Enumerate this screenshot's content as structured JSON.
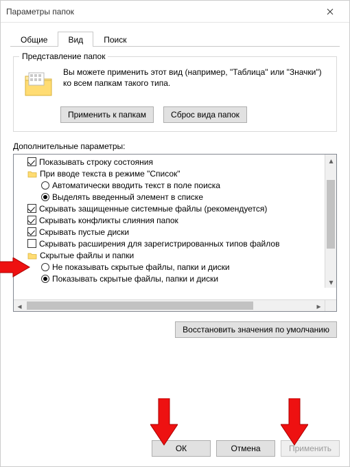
{
  "window": {
    "title": "Параметры папок"
  },
  "tabs": {
    "general": "Общие",
    "view": "Вид",
    "search": "Поиск"
  },
  "folder_views": {
    "legend": "Представление папок",
    "text": "Вы можете применить этот вид (например, \"Таблица\" или \"Значки\") ко всем папкам такого типа.",
    "apply_btn": "Применить к папкам",
    "reset_btn": "Сброс вида папок"
  },
  "advanced": {
    "label": "Дополнительные параметры:",
    "items": [
      {
        "kind": "check",
        "checked": true,
        "label": "Показывать строку состояния"
      },
      {
        "kind": "folder",
        "label": "При вводе текста в режиме \"Список\""
      },
      {
        "kind": "radio",
        "checked": false,
        "child": true,
        "label": "Автоматически вводить текст в поле поиска"
      },
      {
        "kind": "radio",
        "checked": true,
        "child": true,
        "label": "Выделять введенный элемент в списке"
      },
      {
        "kind": "check",
        "checked": true,
        "label": "Скрывать защищенные системные файлы (рекомендуется)"
      },
      {
        "kind": "check",
        "checked": true,
        "label": "Скрывать конфликты слияния папок"
      },
      {
        "kind": "check",
        "checked": true,
        "label": "Скрывать пустые диски"
      },
      {
        "kind": "check",
        "checked": false,
        "label": "Скрывать расширения для зарегистрированных типов файлов"
      },
      {
        "kind": "folder",
        "label": "Скрытые файлы и папки"
      },
      {
        "kind": "radio",
        "checked": false,
        "child": true,
        "label": "Не показывать скрытые файлы, папки и диски"
      },
      {
        "kind": "radio",
        "checked": true,
        "child": true,
        "label": "Показывать скрытые файлы, папки и диски"
      }
    ],
    "restore_btn": "Восстановить значения по умолчанию"
  },
  "footer": {
    "ok": "ОК",
    "cancel": "Отмена",
    "apply": "Применить"
  }
}
